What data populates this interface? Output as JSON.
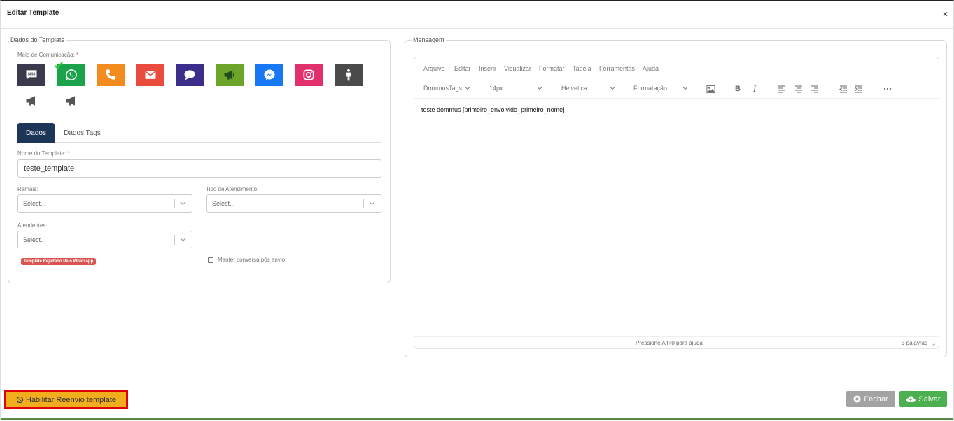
{
  "modal": {
    "title": "Editar Template",
    "close": "×"
  },
  "left_panel": {
    "legend": "Dados do Template",
    "channel_label": "Meio de Comunicação:",
    "required_mark": "*",
    "channels": [
      {
        "name": "sms-icon",
        "text": "SMS",
        "color": "#3a3a4e"
      },
      {
        "name": "whatsapp-icon",
        "color": "#1aa34a",
        "selected": true
      },
      {
        "name": "phone-icon",
        "color": "#f28c1f"
      },
      {
        "name": "email-icon",
        "color": "#e94b3c"
      },
      {
        "name": "chat-icon",
        "color": "#3b2d8a"
      },
      {
        "name": "megaphone-icon",
        "color": "#6da52b"
      },
      {
        "name": "messenger-icon",
        "color": "#1877f2"
      },
      {
        "name": "instagram-icon",
        "color": "#e1306c"
      },
      {
        "name": "person-icon",
        "color": "#4a4a4a"
      },
      {
        "name": "megaphone-outline-icon",
        "color": "#ffffff"
      },
      {
        "name": "megaphone-outline-icon-2",
        "color": "#ffffff"
      }
    ],
    "tabs": [
      {
        "label": "Dados",
        "active": true
      },
      {
        "label": "Dados Tags",
        "active": false
      }
    ],
    "template_name_label": "Nome do Template:",
    "template_name_value": "teste_template",
    "ramais_label": "Ramais:",
    "ramais_placeholder": "Select...",
    "tipo_label": "Tipo de Atendimento:",
    "tipo_placeholder": "Select...",
    "atendentes_label": "Atendentes:",
    "atendentes_placeholder": "Select...",
    "badge": "Template Rejeitado Pelo Whatsapp",
    "keep_conversation_label": "Manter conversa pós envio"
  },
  "right_panel": {
    "legend": "Mensagem",
    "menu": [
      "Arquivo",
      "Editar",
      "Inserir",
      "Visualizar",
      "Formatar",
      "Tabela",
      "Ferramentas",
      "Ajuda"
    ],
    "toolbar": {
      "tags_dropdown": "DommusTags",
      "font_size": "14px",
      "font_family": "Helvetica",
      "format": "Formatação"
    },
    "content": "teste dommus [primeiro_envolvido_primeiro_nome]",
    "status_hint": "Pressione Alt+0 para ajuda",
    "word_count": "3 palavras"
  },
  "footer": {
    "reenvio_label": "Habilitar Reenvio template",
    "fechar_label": "Fechar",
    "salvar_label": "Salvar"
  }
}
